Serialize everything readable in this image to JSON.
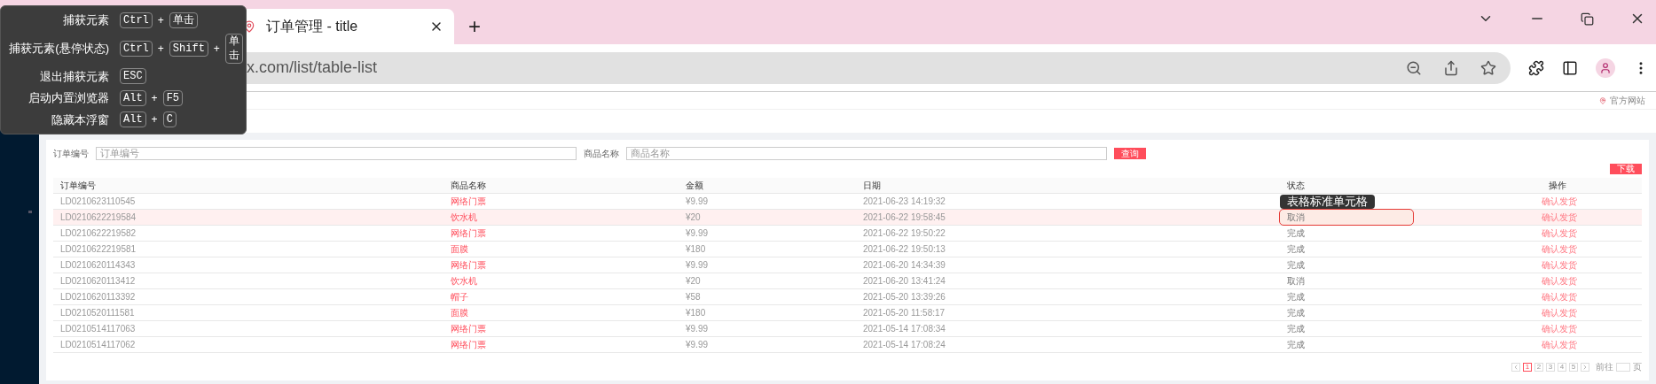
{
  "browser": {
    "tabs": [
      {
        "label": "订单管理 - title",
        "selected": true
      }
    ],
    "new_tab": "+",
    "address": "x.com/list/table-list"
  },
  "page": {
    "header_link": "官方网站",
    "search": [
      {
        "label": "订单编号",
        "placeholder": "订单编号"
      },
      {
        "label": "商品名称",
        "placeholder": "商品名称"
      }
    ],
    "query_button": "查询",
    "download_button": "下载",
    "table": {
      "columns": [
        "订单编号",
        "商品名称",
        "金额",
        "日期",
        "状态",
        "操作"
      ],
      "rows": [
        {
          "order_no": "LD0210623110545",
          "product": "网络门票",
          "amount": "¥9.99",
          "date": "2021-06-23 14:19:32",
          "action": "确认发货",
          "highlighted": false,
          "inspected": false
        },
        {
          "order_no": "LD0210622219584",
          "product": "饮水机",
          "amount": "¥20",
          "date": "2021-06-22 19:58:45",
          "status": "取消",
          "action": "确认发货",
          "highlighted": true,
          "inspected": true
        },
        {
          "order_no": "LD0210622219582",
          "product": "网络门票",
          "amount": "¥9.99",
          "date": "2021-06-22 19:50:22",
          "status": "完成",
          "action": "确认发货",
          "highlighted": false,
          "inspected": false
        },
        {
          "order_no": "LD0210622219581",
          "product": "面膜",
          "amount": "¥180",
          "date": "2021-06-22 19:50:13",
          "status": "完成",
          "action": "确认发货",
          "highlighted": false,
          "inspected": false
        },
        {
          "order_no": "LD0210620114343",
          "product": "网络门票",
          "amount": "¥9.99",
          "date": "2021-06-20 14:34:39",
          "status": "完成",
          "action": "确认发货",
          "highlighted": false,
          "inspected": false
        },
        {
          "order_no": "LD0210620113412",
          "product": "饮水机",
          "amount": "¥20",
          "date": "2021-06-20 13:41:24",
          "status": "取消",
          "action": "确认发货",
          "highlighted": false,
          "inspected": false
        },
        {
          "order_no": "LD0210620113392",
          "product": "帽子",
          "amount": "¥58",
          "date": "2021-05-20 13:39:26",
          "status": "完成",
          "action": "确认发货",
          "highlighted": false,
          "inspected": false
        },
        {
          "order_no": "LD0210520111581",
          "product": "面膜",
          "amount": "¥180",
          "date": "2021-05-20 11:58:17",
          "status": "完成",
          "action": "确认发货",
          "highlighted": false,
          "inspected": false
        },
        {
          "order_no": "LD0210514117063",
          "product": "网络门票",
          "amount": "¥9.99",
          "date": "2021-05-14 17:08:34",
          "status": "完成",
          "action": "确认发货",
          "highlighted": false,
          "inspected": false
        },
        {
          "order_no": "LD0210514117062",
          "product": "网络门票",
          "amount": "¥9.99",
          "date": "2021-05-14 17:08:24",
          "status": "完成",
          "action": "确认发货",
          "highlighted": false,
          "inspected": false
        }
      ]
    },
    "pagination": {
      "pages": [
        {
          "label": "1",
          "selected": true
        },
        {
          "label": "2",
          "selected": false
        },
        {
          "label": "3",
          "selected": false
        },
        {
          "label": "4",
          "selected": false
        },
        {
          "label": "5",
          "selected": false
        }
      ],
      "goto_prefix": "前往",
      "goto_suffix": "页"
    }
  },
  "overlay": {
    "shortcuts": [
      {
        "label": "捕获元素",
        "keys": [
          "Ctrl",
          "单击"
        ]
      },
      {
        "label": "捕获元素(悬停状态)",
        "keys": [
          "Ctrl",
          "Shift",
          "单击"
        ]
      },
      {
        "label": "退出捕获元素",
        "keys": [
          "ESC"
        ]
      },
      {
        "label": "启动内置浏览器",
        "keys": [
          "Alt",
          "F5"
        ]
      },
      {
        "label": "隐藏本浮窗",
        "keys": [
          "Alt",
          "C"
        ]
      }
    ],
    "joiner": "+",
    "tooltip": "表格标准单元格"
  }
}
